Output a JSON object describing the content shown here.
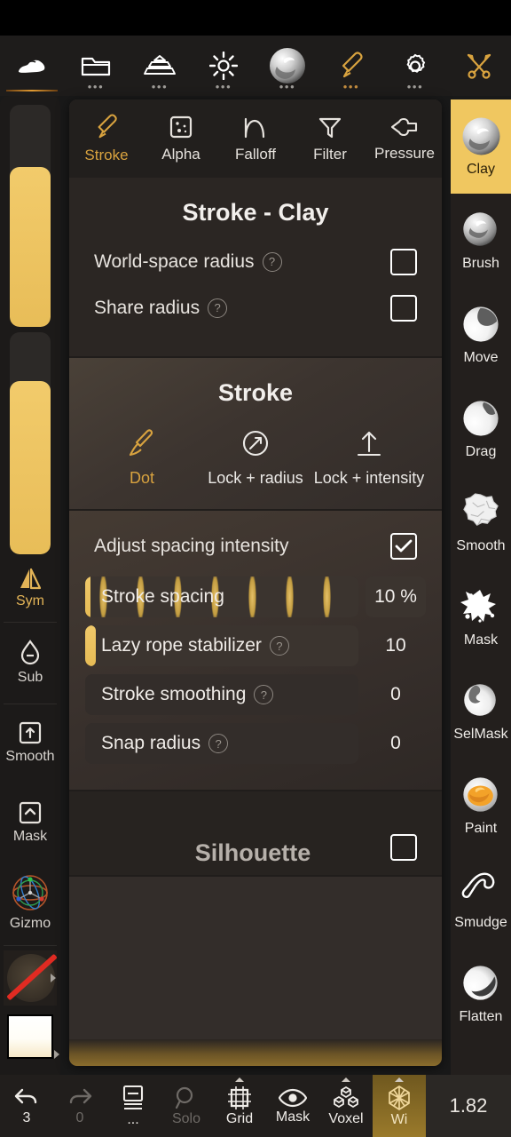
{
  "app": {
    "version_label": "1.82",
    "accent_gold": "#d9a33f",
    "accent_gold_bright": "#f0c760",
    "panel_bg": "#332d2a"
  },
  "topbar": {
    "items": [
      {
        "label": "",
        "icon": "clay-blob-icon",
        "dots": false,
        "active": true
      },
      {
        "label": "",
        "icon": "folder-icon",
        "dots": true,
        "active": false
      },
      {
        "label": "",
        "icon": "layers-stack-icon",
        "dots": true,
        "active": false
      },
      {
        "label": "",
        "icon": "lighting-sun-icon",
        "dots": true,
        "active": false
      },
      {
        "label": "",
        "icon": "material-sphere-icon",
        "dots": true,
        "active": false
      },
      {
        "label": "",
        "icon": "brush-pen-icon",
        "dots": true,
        "active": false,
        "gold": true
      },
      {
        "label": "",
        "icon": "gear-icon",
        "dots": true,
        "active": false
      },
      {
        "label": "",
        "icon": "tools-wrench-icon",
        "dots": false,
        "active": false,
        "gold": true
      }
    ]
  },
  "left_rail": {
    "radius_slider": {
      "name": "radius-slider",
      "value_pct": 72
    },
    "intensity_slider": {
      "name": "intensity-slider",
      "value_pct": 78
    },
    "buttons": [
      {
        "label": "Sym",
        "icon": "symmetry-icon",
        "gold": true
      },
      {
        "label": "Sub",
        "icon": "subtract-drop-icon",
        "gold": false
      },
      {
        "label": "Smooth",
        "icon": "smooth-box-up-icon",
        "gold": false
      },
      {
        "label": "Mask",
        "icon": "mask-box-icon",
        "gold": false
      },
      {
        "label": "Gizmo",
        "icon": "gizmo-axis-icon",
        "gold": false
      }
    ],
    "alpha_swatch": {
      "name": "alpha-swatch",
      "state": "none"
    },
    "color_swatch": {
      "name": "color-swatch",
      "color": "#fffdf6"
    }
  },
  "panel": {
    "tabs": [
      {
        "label": "Stroke",
        "icon": "brush-pen-icon",
        "active": true
      },
      {
        "label": "Alpha",
        "icon": "alpha-square-icon",
        "active": false
      },
      {
        "label": "Falloff",
        "icon": "falloff-curve-icon",
        "active": false
      },
      {
        "label": "Filter",
        "icon": "filter-funnel-icon",
        "active": false
      },
      {
        "label": "Pressure",
        "icon": "pressure-hand-icon",
        "active": false
      }
    ],
    "section_stroke_clay": {
      "title": "Stroke - Clay",
      "rows": [
        {
          "label": "World-space radius",
          "help": true,
          "checked": false
        },
        {
          "label": "Share radius",
          "help": true,
          "checked": false
        }
      ]
    },
    "section_stroke": {
      "title": "Stroke",
      "modes": [
        {
          "label": "Dot",
          "icon": "dot-brush-icon",
          "active": true
        },
        {
          "label": "Lock + radius",
          "icon": "lock-radius-icon",
          "active": false
        },
        {
          "label": "Lock + intensity",
          "icon": "lock-intensity-icon",
          "active": false
        }
      ]
    },
    "section_spacing": {
      "toggle": {
        "label": "Adjust spacing intensity",
        "checked": true
      },
      "sliders": [
        {
          "label": "Stroke spacing",
          "help": false,
          "value": "10 %",
          "fill_pct": 10,
          "lens_marks": 7,
          "boxed": true
        },
        {
          "label": "Lazy rope stabilizer",
          "help": true,
          "value": "10",
          "fill_pct": 4,
          "lens_marks": 0,
          "boxed": true
        },
        {
          "label": "Stroke smoothing",
          "help": true,
          "value": "0",
          "fill_pct": 0,
          "lens_marks": 0,
          "boxed": false
        },
        {
          "label": "Snap radius",
          "help": true,
          "value": "0",
          "fill_pct": 0,
          "lens_marks": 0,
          "boxed": false
        }
      ]
    },
    "section_silhouette": {
      "title": "Silhouette",
      "checked": false
    }
  },
  "right_rail": {
    "brushes": [
      {
        "label": "Clay",
        "icon": "clay-sphere-icon",
        "active": true
      },
      {
        "label": "Brush",
        "icon": "brush-sphere-icon",
        "active": false
      },
      {
        "label": "Move",
        "icon": "move-sphere-icon",
        "active": false
      },
      {
        "label": "Drag",
        "icon": "drag-sphere-icon",
        "active": false
      },
      {
        "label": "Smooth",
        "icon": "smooth-rock-icon",
        "active": false
      },
      {
        "label": "Mask",
        "icon": "mask-splat-icon",
        "active": false
      },
      {
        "label": "SelMask",
        "icon": "selmask-sphere-icon",
        "active": false
      },
      {
        "label": "Paint",
        "icon": "paint-sphere-icon",
        "active": false
      },
      {
        "label": "Smudge",
        "icon": "smudge-icon",
        "active": false
      },
      {
        "label": "Flatten",
        "icon": "flatten-sphere-icon",
        "active": false
      }
    ]
  },
  "bottombar": {
    "items": [
      {
        "label": "3",
        "icon": "undo-icon",
        "dim": false,
        "caret": false,
        "highlight": false
      },
      {
        "label": "0",
        "icon": "redo-icon",
        "dim": true,
        "caret": false,
        "highlight": false
      },
      {
        "label": "...",
        "icon": "layers-icon",
        "dim": false,
        "caret": false,
        "highlight": false
      },
      {
        "label": "Solo",
        "icon": "solo-magnifier-icon",
        "dim": true,
        "caret": false,
        "highlight": false
      },
      {
        "label": "Grid",
        "icon": "grid-icon",
        "dim": false,
        "caret": true,
        "highlight": false
      },
      {
        "label": "Mask",
        "icon": "eye-icon",
        "dim": false,
        "caret": false,
        "highlight": false
      },
      {
        "label": "Voxel",
        "icon": "voxel-cubes-icon",
        "dim": false,
        "caret": true,
        "highlight": false
      },
      {
        "label": "Wi",
        "icon": "wireframe-icon",
        "dim": false,
        "caret": true,
        "highlight": true
      }
    ]
  }
}
